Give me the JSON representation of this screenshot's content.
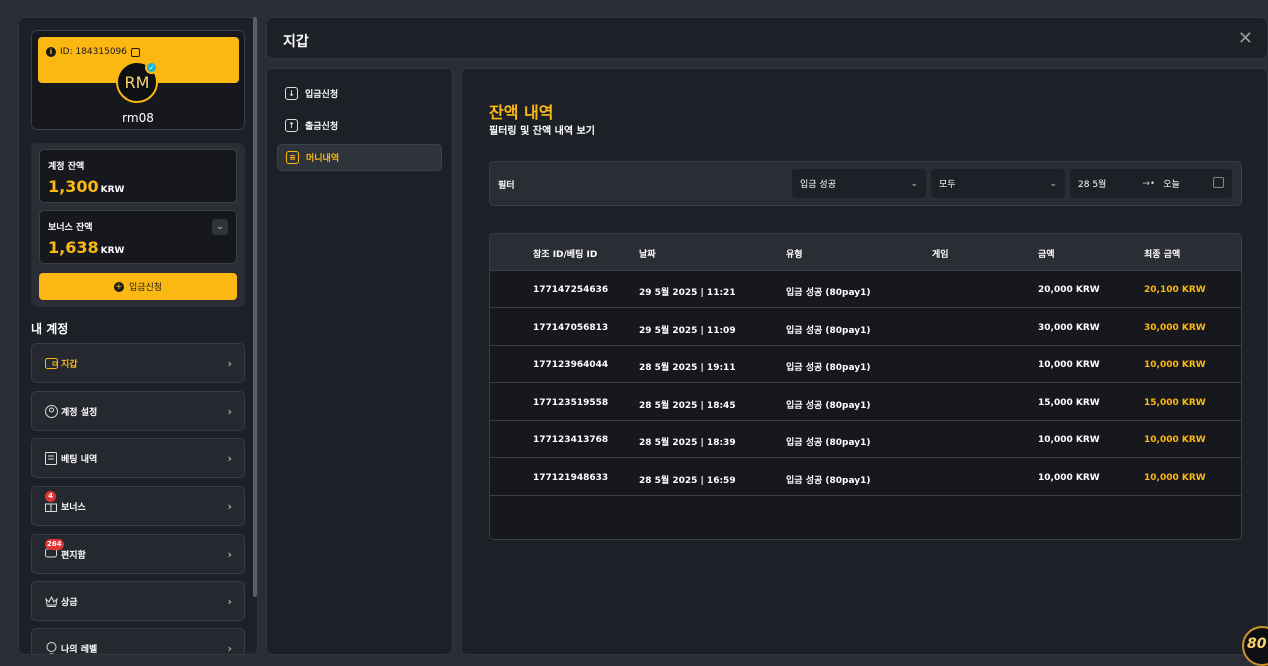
{
  "profile": {
    "id_text": "ID: 184315096",
    "initials": "RM",
    "username": "rm08"
  },
  "balances": {
    "account_label": "계정 잔액",
    "account_value": "1,300",
    "account_unit": "KRW",
    "bonus_label": "보너스 잔액",
    "bonus_value": "1,638",
    "bonus_unit": "KRW",
    "deposit_button": "입금신청"
  },
  "my_account": {
    "title": "내 계정",
    "items": [
      {
        "label": "지갑",
        "icon": "wallet-icon",
        "active": true
      },
      {
        "label": "계정 설정",
        "icon": "user-settings-icon"
      },
      {
        "label": "베팅 내역",
        "icon": "receipt-icon"
      },
      {
        "label": "보너스",
        "icon": "gift-icon",
        "badge": "4"
      },
      {
        "label": "편지함",
        "icon": "message-icon",
        "badge": "264"
      },
      {
        "label": "상금",
        "icon": "crown-icon"
      },
      {
        "label": "나의 레벨",
        "icon": "level-icon"
      }
    ]
  },
  "header": {
    "title": "지갑",
    "close": "✕"
  },
  "wallet_nav": [
    {
      "label": "입금신청",
      "icon": "deposit-icon"
    },
    {
      "label": "출금신청",
      "icon": "withdraw-icon"
    },
    {
      "label": "머니내역",
      "icon": "money-history-icon",
      "active": true
    }
  ],
  "main": {
    "title": "잔액 내역",
    "subtitle": "필터링 및 잔액 내역 보기",
    "filter_label": "필터",
    "filter_status": "입금 성공",
    "filter_type": "모두",
    "date_from": "28 5월",
    "date_to": "오늘"
  },
  "table": {
    "headers": [
      "참조 ID/베팅 ID",
      "날짜",
      "유형",
      "게임",
      "금액",
      "최종 금액"
    ],
    "rows": [
      [
        "177147254636",
        "29 5월 2025 | 11:21",
        "입금 성공 (80pay1)",
        "",
        "20,000 KRW",
        "20,100 KRW"
      ],
      [
        "177147056813",
        "29 5월 2025 | 11:09",
        "입금 성공 (80pay1)",
        "",
        "30,000 KRW",
        "30,000 KRW"
      ],
      [
        "177123964044",
        "28 5월 2025 | 19:11",
        "입금 성공 (80pay1)",
        "",
        "10,000 KRW",
        "10,000 KRW"
      ],
      [
        "177123519558",
        "28 5월 2025 | 18:45",
        "입금 성공 (80pay1)",
        "",
        "15,000 KRW",
        "15,000 KRW"
      ],
      [
        "177123413768",
        "28 5월 2025 | 18:39",
        "입금 성공 (80pay1)",
        "",
        "10,000 KRW",
        "10,000 KRW"
      ],
      [
        "177121948633",
        "28 5월 2025 | 16:59",
        "입금 성공 (80pay1)",
        "",
        "10,000 KRW",
        "10,000 KRW"
      ]
    ]
  },
  "brand": {
    "text": "80"
  },
  "colors": {
    "accent": "#fbb813",
    "panel": "#1d2026",
    "background": "#2a2d33"
  }
}
